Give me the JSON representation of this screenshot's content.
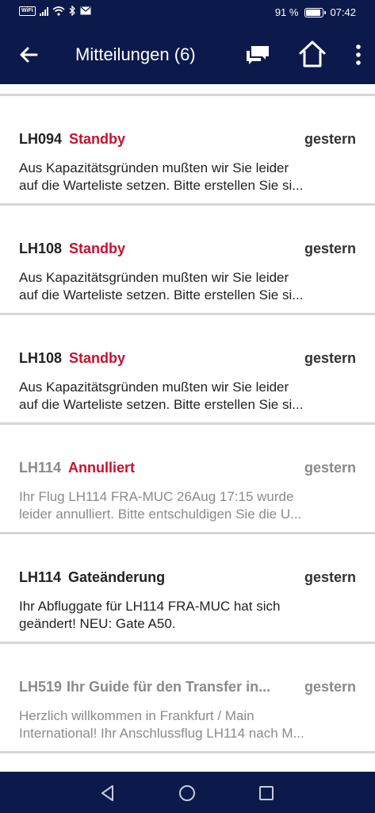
{
  "status_bar": {
    "wifi_label": "WiFi",
    "battery": "91 %",
    "battery_level": 0.91,
    "time": "07:42"
  },
  "header": {
    "title": "Mitteilungen (6)",
    "icons": [
      "back-arrow-icon",
      "chat-icon",
      "home-icon",
      "more-vert-icon"
    ],
    "background": "#0c1a4b"
  },
  "messages": [
    {
      "flight": "LH094",
      "status": "Standby",
      "status_color": "#c8102e",
      "date": "gestern",
      "read": false,
      "line1": "Aus Kapazitätsgründen mußten wir Sie leider",
      "line2": "auf die Warteliste setzen. Bitte erstellen Sie si..."
    },
    {
      "flight": "LH108",
      "status": "Standby",
      "status_color": "#c8102e",
      "date": "gestern",
      "read": false,
      "line1": "Aus Kapazitätsgründen mußten wir Sie leider",
      "line2": "auf die Warteliste setzen. Bitte erstellen Sie si..."
    },
    {
      "flight": "LH108",
      "status": "Standby",
      "status_color": "#c8102e",
      "date": "gestern",
      "read": false,
      "line1": "Aus Kapazitätsgründen mußten wir Sie leider",
      "line2": "auf die Warteliste setzen. Bitte erstellen Sie si..."
    },
    {
      "flight": "LH114",
      "status": "Annulliert",
      "status_color": "#c8102e",
      "date": "gestern",
      "read": true,
      "line1": "Ihr Flug LH114 FRA-MUC 26Aug 17:15 wurde",
      "line2": "leider annulliert. Bitte entschuldigen Sie die U..."
    },
    {
      "flight": "LH114",
      "status": "Gateänderung",
      "status_color": "#222222",
      "date": "gestern",
      "read": false,
      "line1": "Ihr Abfluggate für LH114 FRA-MUC hat sich",
      "line2": "geändert! NEU: Gate A50."
    },
    {
      "flight": "LH519",
      "status": "Ihr Guide für den Transfer in...",
      "status_color": "#8a8a8a",
      "date": "gestern",
      "read": true,
      "line1": "Herzlich willkommen in Frankfurt / Main",
      "line2": "International! Ihr Anschlussflug LH114 nach M..."
    }
  ],
  "nav_bar": {
    "icons": [
      "back-triangle-icon",
      "home-circle-icon",
      "recents-square-icon"
    ]
  }
}
